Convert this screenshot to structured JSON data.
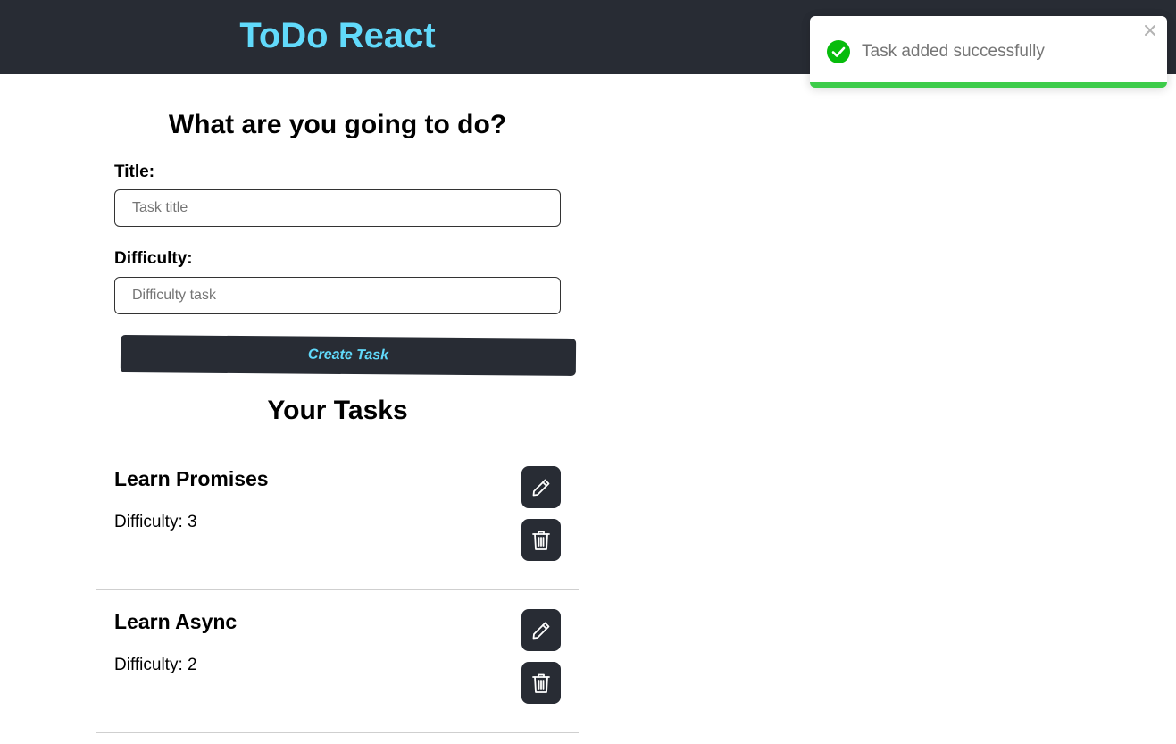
{
  "header": {
    "title": "ToDo React"
  },
  "form": {
    "heading": "What are you going to do?",
    "title_label": "Title:",
    "title_placeholder": "Task title",
    "title_value": "",
    "difficulty_label": "Difficulty:",
    "difficulty_placeholder": "Difficulty task",
    "difficulty_value": "",
    "submit_label": "Create Task"
  },
  "tasks_section": {
    "heading": "Your Tasks",
    "tasks": [
      {
        "title": "Learn Promises",
        "difficulty_text": "Difficulty: 3",
        "edit_icon": "pencil-icon",
        "delete_icon": "trash-icon"
      },
      {
        "title": "Learn Async",
        "difficulty_text": "Difficulty: 2",
        "edit_icon": "pencil-icon",
        "delete_icon": "trash-icon"
      }
    ]
  },
  "toast": {
    "message": "Task added successfully",
    "status": "success",
    "icon": "check-circle-icon",
    "close_icon": "close-icon",
    "progress": 1.0
  },
  "colors": {
    "header_bg": "#282c34",
    "accent": "#61dafb",
    "success": "#3dcc4a",
    "toast_check": "#07bc0c"
  }
}
